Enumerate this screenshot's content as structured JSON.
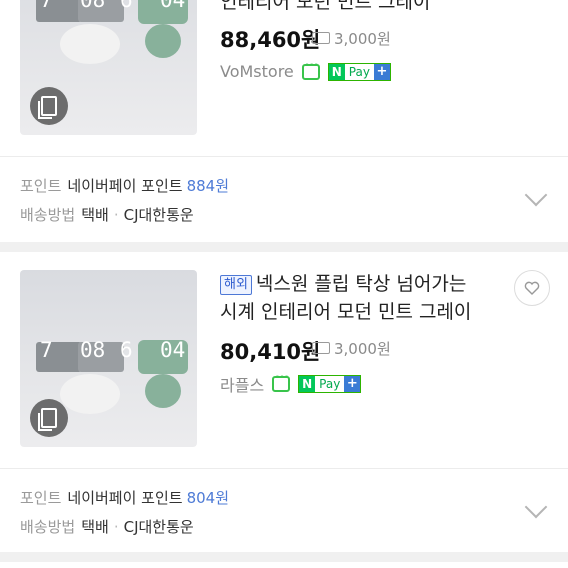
{
  "items": [
    {
      "title_lines": [
        "인테리어 모던 민트 그레이"
      ],
      "price": "88,460원",
      "shipping": "3,000원",
      "store": "VoMstore",
      "points_label": "포인트",
      "points_name": "네이버페이 포인트",
      "points_value": "884원",
      "delivery_label": "배송방법",
      "delivery_method": "택배",
      "carrier": "CJ대한통운"
    },
    {
      "badge": "해외",
      "title_line1": "넥스원 플립 탁상 넘어가는",
      "title_line2": "시계 인테리어 모던 민트 그레이",
      "price": "80,410원",
      "shipping": "3,000원",
      "store": "라플스",
      "points_label": "포인트",
      "points_name": "네이버페이 포인트",
      "points_value": "804원",
      "delivery_label": "배송방법",
      "delivery_method": "택배",
      "carrier": "CJ대한통운"
    }
  ],
  "thumb_digits": [
    "7",
    "08",
    "6",
    "04"
  ],
  "npay": {
    "n": "N",
    "pay": "Pay",
    "plus": "+"
  },
  "colors": {
    "accent_blue": "#4e7bd6",
    "npay_green": "#03c75a",
    "separator": "#f0f0f0"
  }
}
